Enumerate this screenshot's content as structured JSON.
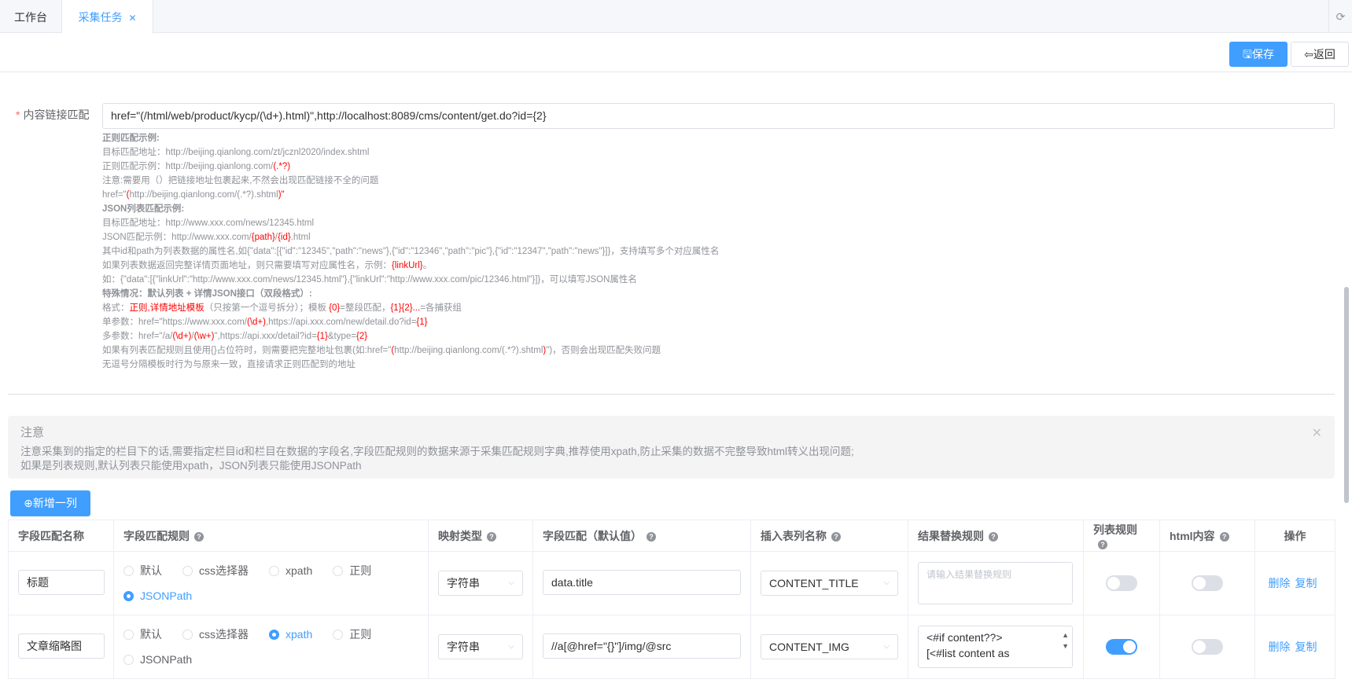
{
  "tabs": [
    {
      "label": "工作台"
    },
    {
      "label": "采集任务",
      "close": "✕"
    }
  ],
  "refresh_icon": "refresh-icon",
  "toolbar": {
    "save_label": "保存",
    "back_label": "返回"
  },
  "link_match": {
    "label": "内容链接匹配",
    "value": "href=\"(/html/web/product/kycp/(\\d+).html)\",http://localhost:8089/cms/content/get.do?id={2}"
  },
  "help": {
    "l1": "正则匹配示例:",
    "l2": "目标匹配地址：http://beijing.qianlong.com/zt/jcznl2020/index.shtml",
    "l3a": "正则匹配示例：http://beijing.qianlong.com/",
    "l3b": "(.*?)",
    "l4": "注意:需要用（）把链接地址包裹起来,不然会出现匹配链接不全的问题",
    "l5a": "href=\"",
    "l5b": "(",
    "l5c": "http://beijing.qianlong.com/(.*?).shtml",
    "l5d": ")",
    "l5e": "\"",
    "l6": "JSON列表匹配示例:",
    "l7": "目标匹配地址：http://www.xxx.com/news/12345.html",
    "l8a": "JSON匹配示例：http://www.xxx.com/",
    "l8b": "{path}",
    "l8c": "/",
    "l8d": "{id}",
    "l8e": ".html",
    "l9": "其中id和path为列表数据的属性名,如{\"data\":[{\"id\":\"12345\",\"path\":\"news\"},{\"id\":\"12346\",\"path\":\"pic\"},{\"id\":\"12347\",\"path\":\"news\"}]}，支持填写多个对应属性名",
    "l10a": "如果列表数据返回完整详情页面地址，则只需要填写对应属性名，示例：",
    "l10b": "{linkUrl}",
    "l10c": "。",
    "l11": "如：{\"data\":[{\"linkUrl\":\"http://www.xxx.com/news/12345.html\"},{\"linkUrl\":\"http://www.xxx.com/pic/12346.html\"}]}，可以填写JSON属性名",
    "l12": "特殊情况：默认列表 + 详情JSON接口（双段格式）:",
    "l13a": "格式：",
    "l13b": "正则,详情地址模板",
    "l13c": "（只按第一个逗号拆分）；模板 ",
    "l13d": "{0}",
    "l13e": "=整段匹配，",
    "l13f": "{1}{2}...",
    "l13g": "=各捕获组",
    "l14a": "单参数：href=\"https://www.xxx.com/",
    "l14b": "(\\d+)",
    "l14c": ",https://api.xxx.com/new/detail.do?id=",
    "l14d": "{1}",
    "l15a": "多参数：href=\"/a/",
    "l15b": "(\\d+)",
    "l15c": "/",
    "l15d": "(\\w+)",
    "l15e": "\",https://api.xxx/detail?id=",
    "l15f": "{1}",
    "l15g": "&type=",
    "l15h": "{2}",
    "l16a": "如果有列表匹配规则且使用{}占位符时，则需要把完整地址包裹(如:href=\"",
    "l16b": "(",
    "l16c": "http://beijing.qianlong.com/(.*?).shtml",
    "l16d": ")",
    "l16e": "\")，否则会出现匹配失败问题",
    "l17": "无逗号分隔模板时行为与原来一致，直接请求正则匹配到的地址"
  },
  "alert": {
    "title": "注意",
    "line1": "注意采集到的指定的栏目下的话,需要指定栏目id和栏目在数据的字段名,字段匹配规则的数据来源于采集匹配规则字典,推荐使用xpath,防止采集的数据不完整导致html转义出现问题;",
    "line2": "如果是列表规则,默认列表只能使用xpath，JSON列表只能使用JSONPath"
  },
  "add_button": "新增一列",
  "table": {
    "headers": {
      "name": "字段匹配名称",
      "rule": "字段匹配规则",
      "map": "映射类型",
      "def": "字段匹配（默认值）",
      "col": "插入表列名称",
      "rep": "结果替换规则",
      "list": "列表规则",
      "html": "html内容",
      "ops": "操作"
    },
    "radio_options": [
      "默认",
      "css选择器",
      "xpath",
      "正则",
      "JSONPath"
    ],
    "rows": [
      {
        "name": "标题",
        "rule": "JSONPath",
        "map": "字符串",
        "def": "data.title",
        "col": "CONTENT_TITLE",
        "rep_placeholder": "请输入结果替换规则",
        "rep": "",
        "list": false,
        "html": false,
        "delete": "删除",
        "copy": "复制"
      },
      {
        "name": "文章缩略图",
        "rule": "xpath",
        "map": "字符串",
        "def": "//a[@href=\"{}\"]/img/@src",
        "col": "CONTENT_IMG",
        "rep_placeholder": "",
        "rep_l1": "<#if content??>",
        "rep_l2": "[<#list content as",
        "list": true,
        "html": false,
        "delete": "删除",
        "copy": "复制"
      }
    ]
  },
  "colors": {
    "primary": "#409eff",
    "danger": "#f56c6c",
    "highlight": "#ff0000"
  }
}
